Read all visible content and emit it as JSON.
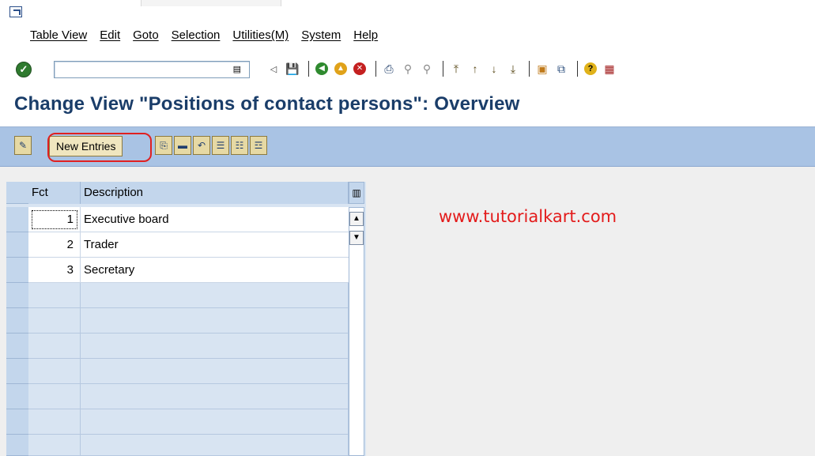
{
  "menu": {
    "items": [
      "Table View",
      "Edit",
      "Goto",
      "Selection",
      "Utilities(M)",
      "System",
      "Help"
    ]
  },
  "toolbar": {
    "command_value": "",
    "icons": [
      "enter-icon",
      "back-icon",
      "save-icon",
      "back-nav-icon",
      "exit-icon",
      "cancel-icon",
      "print-icon",
      "find-icon",
      "find-next-icon",
      "first-page-icon",
      "prev-page-icon",
      "next-page-icon",
      "last-page-icon",
      "new-session-icon",
      "shortcut-icon",
      "help-icon",
      "customize-layout-icon"
    ]
  },
  "header": {
    "title": "Change View \"Positions of contact persons\": Overview"
  },
  "appbar": {
    "new_entries_label": "New Entries",
    "icons": [
      "display-change-icon",
      "copy-as-icon",
      "delete-icon",
      "undo-change-icon",
      "select-all-icon",
      "select-block-icon",
      "deselect-all-icon"
    ]
  },
  "table": {
    "columns": [
      "Fct",
      "Description"
    ],
    "rows": [
      {
        "fct": "1",
        "description": "Executive board"
      },
      {
        "fct": "2",
        "description": "Trader"
      },
      {
        "fct": "3",
        "description": "Secretary"
      }
    ]
  },
  "watermark": {
    "text": "www.tutorialkart.com"
  }
}
